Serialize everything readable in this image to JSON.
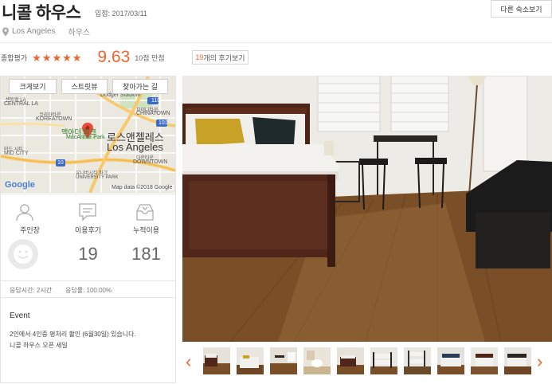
{
  "header": {
    "title": "니콜 하우스",
    "reg_date": "입점: 2017/03/11",
    "other_button": "다른 숙소보기",
    "location": "Los Angeles",
    "house_type": "하우스"
  },
  "rating": {
    "label": "종합평가",
    "stars": 5,
    "score": "9.63",
    "score_suffix": "10점 만점",
    "review_count": "19",
    "review_suffix": "개의 후기보기"
  },
  "map": {
    "buttons": [
      "크게보기",
      "스트릿뷰",
      "찾아가는 길"
    ],
    "labels": {
      "dodger": "Dodger Stadium",
      "central_la": "CENTRAL LA",
      "centro": "센트럴 LA",
      "koreatown": "KOREATOWN",
      "koreatown_kr": "코리아타운",
      "chinatown": "CHINATOWN",
      "chinatown_kr": "차이나타운",
      "macarthur_kr": "맥아더 파크",
      "macarthur": "MacArthur Park",
      "la_kr": "로스앤젤레스",
      "la_en": "Los Angeles",
      "downtown_kr": "다운타운",
      "downtown": "DOWNTOWN",
      "midcity_kr": "미드 시티",
      "midcity": "MID CITY",
      "univ_kr": "유니버시티 파크",
      "univ": "UNIVERSITY PARK",
      "hwy110": "110",
      "hwy101": "101",
      "hwy10": "10",
      "google": "Google",
      "mapdata": "Map data ©2018 Google"
    }
  },
  "stats": {
    "host_label": "주인장",
    "reviews_label": "이용후기",
    "reviews_value": "19",
    "total_label": "누적이용",
    "total_value": "181"
  },
  "response": {
    "time": "응답시간: 2시간",
    "rate": "응답률: 100.00%"
  },
  "event": {
    "title": "Event",
    "line1": "2인에서 4인중 평처리 촬인 (6월30일) 있습니다.",
    "line2": "니콜 하우스 오픈 세일"
  },
  "thumbnails": [
    "photo-1",
    "photo-2",
    "photo-3",
    "photo-4",
    "photo-5",
    "photo-6",
    "photo-7",
    "photo-8",
    "photo-9",
    "photo-10"
  ],
  "colors": {
    "accent": "#f0642d"
  },
  "icons": {
    "pin": "map-pin-icon",
    "host": "person-icon",
    "reviews": "chat-icon",
    "total": "inbox-icon",
    "prev": "chevron-left-icon",
    "next": "chevron-right-icon"
  }
}
